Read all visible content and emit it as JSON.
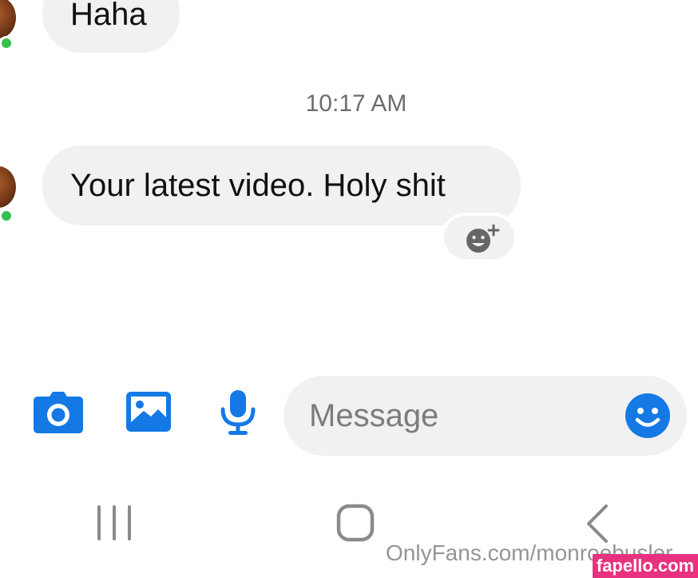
{
  "conversation": {
    "messages": [
      {
        "text": "Haha"
      },
      {
        "text": "Your latest video. Holy shit"
      }
    ],
    "timestamp": "10:17 AM"
  },
  "composer": {
    "placeholder": "Message",
    "icons": [
      "camera-icon",
      "gallery-icon",
      "microphone-icon",
      "emoji-icon"
    ]
  },
  "navigation": {
    "icons": [
      "recent-apps-icon",
      "home-icon",
      "back-icon"
    ]
  },
  "watermark": {
    "text": "OnlyFans.com/monroebusler",
    "badge": "fapello.com"
  },
  "colors": {
    "accent_blue": "#1479e4",
    "bubble_gray": "#f1f1f1",
    "online_green": "#31c24d",
    "nav_gray": "#8a8a8a",
    "badge_pink": "#e8327f"
  }
}
